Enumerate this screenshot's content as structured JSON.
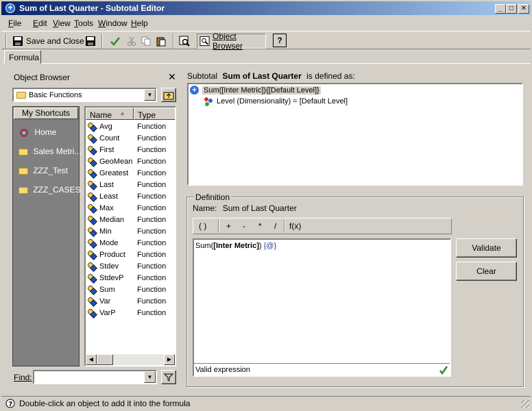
{
  "window": {
    "title": "Sum of Last Quarter - Subtotal Editor",
    "minimize_glyph": "_",
    "maximize_glyph": "□",
    "close_glyph": "✕"
  },
  "menu": [
    {
      "underline": "F",
      "rest": "ile"
    },
    {
      "underline": "E",
      "rest": "dit"
    },
    {
      "underline": "V",
      "rest": "iew"
    },
    {
      "underline": "T",
      "rest": "ools"
    },
    {
      "underline": "W",
      "rest": "indow"
    },
    {
      "underline": "H",
      "rest": "elp"
    }
  ],
  "toolbar": {
    "save_close_label": "Save and Close",
    "object_browser_label": "Object Browser"
  },
  "tabs": {
    "formula": "Formula"
  },
  "object_browser": {
    "title": "Object Browser",
    "close_glyph": "✕",
    "folder": "Basic Functions",
    "shortcuts_header": "My Shortcuts",
    "shortcuts": [
      "Home",
      "Sales Metri...",
      "ZZZ_Test",
      "ZZZ_CASES"
    ],
    "columns": {
      "name": "Name",
      "type": "Type"
    },
    "functions": [
      {
        "name": "Avg",
        "type": "Function"
      },
      {
        "name": "Count",
        "type": "Function"
      },
      {
        "name": "First",
        "type": "Function"
      },
      {
        "name": "GeoMean",
        "type": "Function"
      },
      {
        "name": "Greatest",
        "type": "Function"
      },
      {
        "name": "Last",
        "type": "Function"
      },
      {
        "name": "Least",
        "type": "Function"
      },
      {
        "name": "Max",
        "type": "Function"
      },
      {
        "name": "Median",
        "type": "Function"
      },
      {
        "name": "Min",
        "type": "Function"
      },
      {
        "name": "Mode",
        "type": "Function"
      },
      {
        "name": "Product",
        "type": "Function"
      },
      {
        "name": "Stdev",
        "type": "Function"
      },
      {
        "name": "StdevP",
        "type": "Function"
      },
      {
        "name": "Sum",
        "type": "Function"
      },
      {
        "name": "Var",
        "type": "Function"
      },
      {
        "name": "VarP",
        "type": "Function"
      }
    ],
    "find_label": "Find:",
    "find_value": ""
  },
  "subtotal": {
    "prefix": "Subtotal",
    "name": "Sum of Last Quarter",
    "suffix": "is defined as:",
    "tree_root": "Sum([Inter Metric]){[Default Level]}",
    "tree_child": "Level (Dimensionality) = [Default Level]"
  },
  "definition": {
    "legend": "Definition",
    "name_label": "Name:",
    "name_value": "Sum of Last Quarter",
    "operators": [
      "( )",
      "+",
      "-",
      "*",
      "/",
      "f(x)"
    ],
    "formula_prefix": "Sum(",
    "formula_bold": "[Inter Metric]",
    "formula_close": ")",
    "formula_suffix": " {@}",
    "validation": "Valid expression",
    "validate_label": "Validate",
    "clear_label": "Clear"
  },
  "status_bar": {
    "text": "Double-click an object to add it into the formula"
  }
}
